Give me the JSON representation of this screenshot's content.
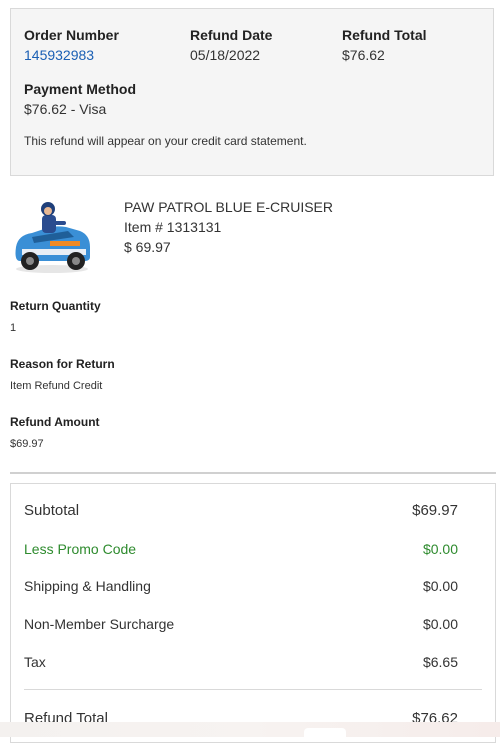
{
  "summary": {
    "order_number_label": "Order Number",
    "order_number": "145932983",
    "refund_date_label": "Refund Date",
    "refund_date": "05/18/2022",
    "refund_total_label": "Refund Total",
    "refund_total": "$76.62",
    "payment_method_label": "Payment Method",
    "payment_method": "$76.62 - Visa",
    "note": "This refund will appear on your credit card statement."
  },
  "product": {
    "name": "PAW PATROL BLUE E-CRUISER",
    "item_number": "Item # 1313131",
    "price": "$ 69.97",
    "image_icon": "ride-on-car-image"
  },
  "details": {
    "return_quantity_label": "Return Quantity",
    "return_quantity": "1",
    "reason_label": "Reason for Return",
    "reason": "Item Refund Credit",
    "refund_amount_label": "Refund Amount",
    "refund_amount": "$69.97"
  },
  "totals": {
    "subtotal_label": "Subtotal",
    "subtotal": "$69.97",
    "promo_label": "Less Promo Code",
    "promo": "$0.00",
    "shipping_label": "Shipping & Handling",
    "shipping": "$0.00",
    "surcharge_label": "Non-Member Surcharge",
    "surcharge": "$0.00",
    "tax_label": "Tax",
    "tax": "$6.65",
    "refund_total_label": "Refund Total",
    "refund_total": "$76.62"
  },
  "colors": {
    "link": "#1a5fb4",
    "promo": "#2e8b2e"
  }
}
